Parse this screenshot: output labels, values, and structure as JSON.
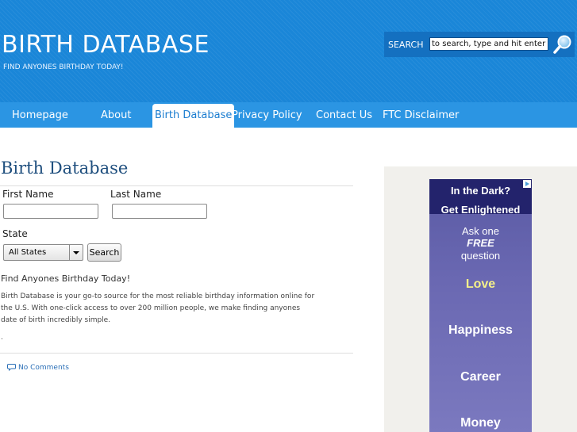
{
  "header": {
    "site_title": "BIRTH DATABASE",
    "tagline": "FIND ANYONES BIRTHDAY TODAY!",
    "search_label": "SEARCH",
    "search_placeholder": "to search, type and hit enter",
    "search_icon": "magnifier-icon"
  },
  "nav": {
    "items": [
      {
        "label": "Homepage"
      },
      {
        "label": "About"
      },
      {
        "label": "Birth Database",
        "active": true
      },
      {
        "label": "Privacy Policy"
      },
      {
        "label": "Contact Us"
      },
      {
        "label": "FTC Disclaimer"
      }
    ]
  },
  "content": {
    "title": "Birth Database",
    "form": {
      "first_name_label": "First Name",
      "last_name_label": "Last Name",
      "first_name_value": "",
      "last_name_value": "",
      "state_label": "State",
      "state_selected": "All States",
      "search_button": "Search"
    },
    "intro": "Find Anyones Birthday Today!",
    "description": "Birth Database is your go-to source for the most reliable birthday information online for the U.S. With one-click access to over 200 million people, we make finding anyones date of birth incredibly simple.",
    "dot": ".",
    "comments_link": "No Comments",
    "comments_icon": "speech-bubble-icon"
  },
  "sidebar_ad": {
    "headline_1": "In the Dark?",
    "headline_2": "Get Enlightened",
    "ask_1": "Ask one",
    "ask_2": "FREE",
    "ask_3": "question",
    "topics": [
      "Love",
      "Happiness",
      "Career",
      "Money"
    ],
    "ad_choices_icon": "ad-choices-icon",
    "colors": {
      "head": "#23236c",
      "body": "#6a68b2",
      "highlight": "#f5f08a"
    }
  },
  "colors": {
    "header_bg": "#1a86d8",
    "nav_bg": "#2b95e3",
    "title_text": "#1f4f7e",
    "link": "#2a6fb7"
  }
}
